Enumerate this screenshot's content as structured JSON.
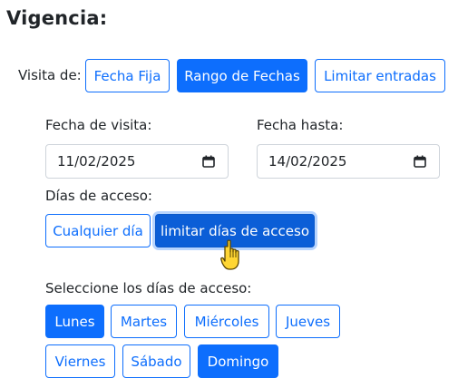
{
  "heading": "Vigencia:",
  "visit_type": {
    "label": "Visita de:",
    "options": [
      "Fecha Fija",
      "Rango de Fechas",
      "Limitar entradas"
    ],
    "selected": "Rango de Fechas"
  },
  "dates": {
    "from_label": "Fecha de visita:",
    "from_value": "11/02/2025",
    "to_label": "Fecha hasta:",
    "to_value": "14/02/2025"
  },
  "access_days": {
    "label": "Días de acceso:",
    "any_day": "Cualquier día",
    "limit_days": "limitar días de acceso"
  },
  "day_select": {
    "label": "Seleccione los días de acceso:",
    "days": [
      "Lunes",
      "Martes",
      "Miércoles",
      "Jueves",
      "Viernes",
      "Sábado",
      "Domingo"
    ],
    "selected": [
      "Lunes",
      "Domingo"
    ]
  },
  "colors": {
    "primary": "#0d6efd",
    "primary_dark": "#0b5ed7",
    "text": "#212529",
    "input_border": "#ced4da"
  },
  "icons": {
    "date_picker": "calendar-icon",
    "pointer": "hand-pointer-icon"
  }
}
